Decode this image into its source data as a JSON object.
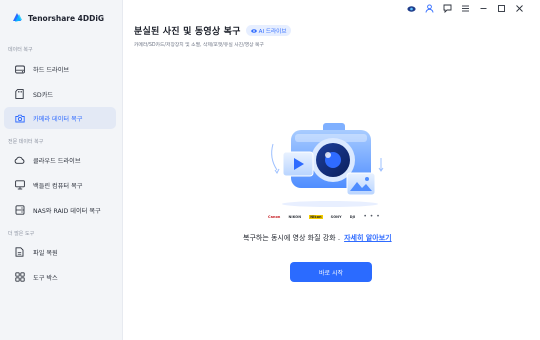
{
  "app": {
    "name": "Tenorshare 4DDiG"
  },
  "sidebar": {
    "sections": [
      {
        "title": "데이터 복구"
      },
      {
        "title": "전문 데이터 복구"
      },
      {
        "title": "더 많은 도구"
      }
    ],
    "items": [
      {
        "label": "하드 드라이브",
        "icon": "hard-drive-icon"
      },
      {
        "label": "SD카드",
        "icon": "sd-card-icon"
      },
      {
        "label": "카메라 데이터 복구",
        "icon": "camera-icon",
        "active": true
      },
      {
        "label": "클라우드 드라이브",
        "icon": "cloud-icon"
      },
      {
        "label": "백들린 컴퓨터 복구",
        "icon": "computer-icon"
      },
      {
        "label": "NAS와 RAID 데이터 복구",
        "icon": "nas-icon"
      },
      {
        "label": "파일 복원",
        "icon": "file-repair-icon"
      },
      {
        "label": "도구 박스",
        "icon": "toolbox-icon"
      }
    ]
  },
  "topbar": {
    "icons": [
      "vip-icon",
      "account-icon",
      "feedback-icon",
      "menu-icon",
      "minimize-icon",
      "maximize-icon",
      "close-icon"
    ]
  },
  "main": {
    "title": "분실된 사진 및 동영상 복구",
    "ai_badge": "AI 드라이브",
    "subtitle": "카메라/SD카드/저장장치 및 소멸, 삭제/포맷/유실 사진/영상 복구",
    "brands": [
      "Canon",
      "NIKON",
      "Nikon",
      "SONY",
      "DJI"
    ],
    "more": "• • •",
    "tagline": "복구하는 동시에 영상 화질 강화 .",
    "learn_more": "자세히 알아보기",
    "start_button": "바로 시작"
  },
  "colors": {
    "accent": "#2b6bff",
    "sidebar_bg": "#f3f5f8",
    "active_bg": "#e3e9f5"
  }
}
